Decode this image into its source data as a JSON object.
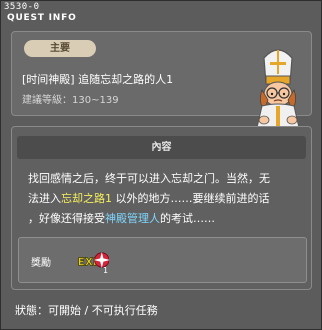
{
  "window": {
    "quest_id": "3530-0",
    "title": "QUEST INFO"
  },
  "quest": {
    "tag": "主要",
    "name": "[时间神殿] 追随忘却之路的人1",
    "level_requirement": "建議等級：130~139"
  },
  "content": {
    "header": "內容",
    "line1": "找回感情之后，终于可以进入忘却之门。当然，无",
    "line2_pre": "法进入",
    "line2_highlight": "忘却之路1",
    "line2_post": " 以外的地方……要继续前进的话",
    "line3_pre": "，好像还得接受",
    "line3_npc": "神殿管理人",
    "line3_post": "的考试……"
  },
  "reward": {
    "label": "獎勵",
    "exp_count": "1",
    "exp_icon": "exp-icon"
  },
  "status": {
    "text": "狀態：可開始 / 不可执行任務"
  },
  "colors": {
    "background": "#5c5c5c",
    "tag_bg": "#d9cdb6",
    "highlight_yellow": "#f7ef5c",
    "npc_link_blue": "#7fd6ff"
  }
}
